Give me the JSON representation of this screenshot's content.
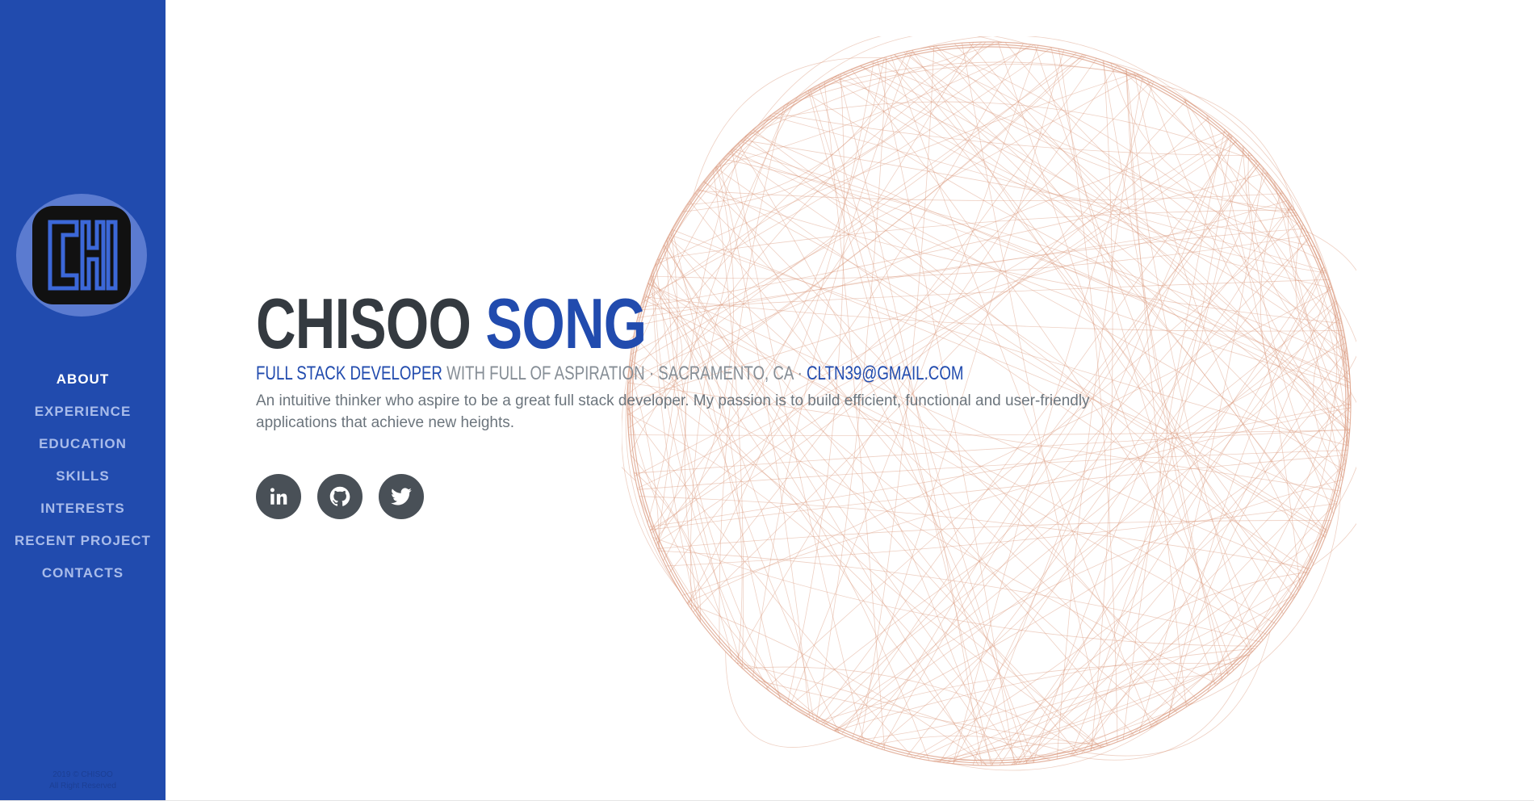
{
  "brand": {
    "logo_text": "CHI"
  },
  "nav": {
    "items": [
      {
        "label": "ABOUT",
        "active": true
      },
      {
        "label": "EXPERIENCE"
      },
      {
        "label": "EDUCATION"
      },
      {
        "label": "SKILLS"
      },
      {
        "label": "INTERESTS"
      },
      {
        "label": "RECENT PROJECT"
      },
      {
        "label": "CONTACTS"
      }
    ]
  },
  "footer": {
    "line1": "2019 © CHISOO",
    "line2": "All Right Reserved"
  },
  "hero": {
    "first_name": "CHISOO",
    "last_name": "SONG",
    "role": "FULL STACK DEVELOPER",
    "tagline": " WITH FULL OF ASPIRATION · SACRAMENTO, CA · ",
    "email": "CLTN39@GMAIL.COM",
    "lead": "An intuitive thinker who aspire to be a great full stack developer. My passion is to build efficient, functional and user-friendly applications that achieve new heights."
  },
  "social": [
    {
      "name": "linkedin",
      "icon": "linkedin-icon"
    },
    {
      "name": "github",
      "icon": "github-icon"
    },
    {
      "name": "twitter",
      "icon": "twitter-icon"
    }
  ],
  "colors": {
    "sidebar": "#214bae",
    "accent": "#214bae",
    "orb": "#d9967a",
    "social_bg": "#495057"
  }
}
